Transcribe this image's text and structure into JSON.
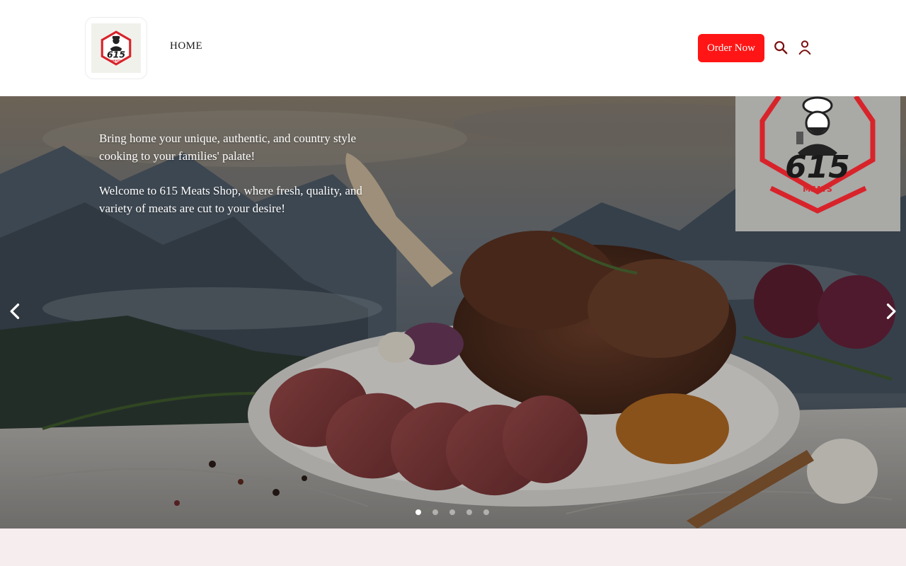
{
  "header": {
    "logo_text": "615",
    "logo_subtext": "MEATS",
    "nav": {
      "home_label": "HOME"
    },
    "order_button_label": "Order Now",
    "icons": {
      "search": "search-icon",
      "account": "user-icon"
    },
    "colors": {
      "accent": "#ff1515",
      "logo_red": "#d8232a"
    }
  },
  "hero": {
    "tagline": "Bring home your unique, authentic, and country style cooking to your families' palate!",
    "welcome": "Welcome to 615 Meats Shop, where fresh, quality, and variety of meats are cut to your desire!",
    "logo_text": "615",
    "logo_subtext": "MEATS",
    "carousel": {
      "prev_icon": "chevron-left-icon",
      "next_icon": "chevron-right-icon",
      "slide_count": 5,
      "active_index": 0
    }
  },
  "section": {
    "title": ""
  }
}
